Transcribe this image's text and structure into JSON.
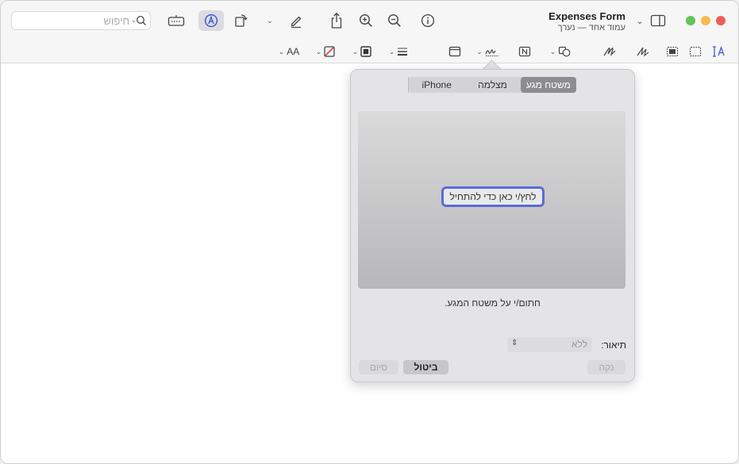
{
  "window": {
    "title": "Expenses Form",
    "subtitle": "עמוד אחד — נערך"
  },
  "search": {
    "placeholder": "חיפוש"
  },
  "toolbar2": {
    "text_size_label": "AA"
  },
  "colors": {
    "accent": "#5a6bd8",
    "close": "#ec5f57",
    "minimize": "#f5bd4f",
    "zoom": "#61c554"
  },
  "signature_popover": {
    "tabs": [
      {
        "label": "משטח מגע",
        "selected": true
      },
      {
        "label": "מצלמה",
        "selected": false
      },
      {
        "label": "iPhone",
        "selected": false
      }
    ],
    "click_to_begin": "לחץ/י כאן כדי להתחיל",
    "instruction": "חתום/י על משטח המגע.",
    "description_label": "תיאור:",
    "description_value": "ללא",
    "buttons": {
      "clear": "נקה",
      "cancel": "ביטול",
      "done": "סיום"
    }
  },
  "icons": [
    "search-icon",
    "keyboard-icon",
    "markup-icon",
    "rotate-icon",
    "highlight-pen-icon",
    "share-icon",
    "zoom-in-icon",
    "zoom-out-icon",
    "info-icon",
    "sidebar-icon",
    "text-cursor-icon",
    "rect-select-icon",
    "smart-lasso-icon",
    "sketch-icon",
    "draw-icon",
    "shapes-icon",
    "textbox-icon",
    "signature-icon",
    "note-icon",
    "line-style-icon",
    "border-color-icon",
    "fill-color-icon",
    "text-style-icon"
  ]
}
